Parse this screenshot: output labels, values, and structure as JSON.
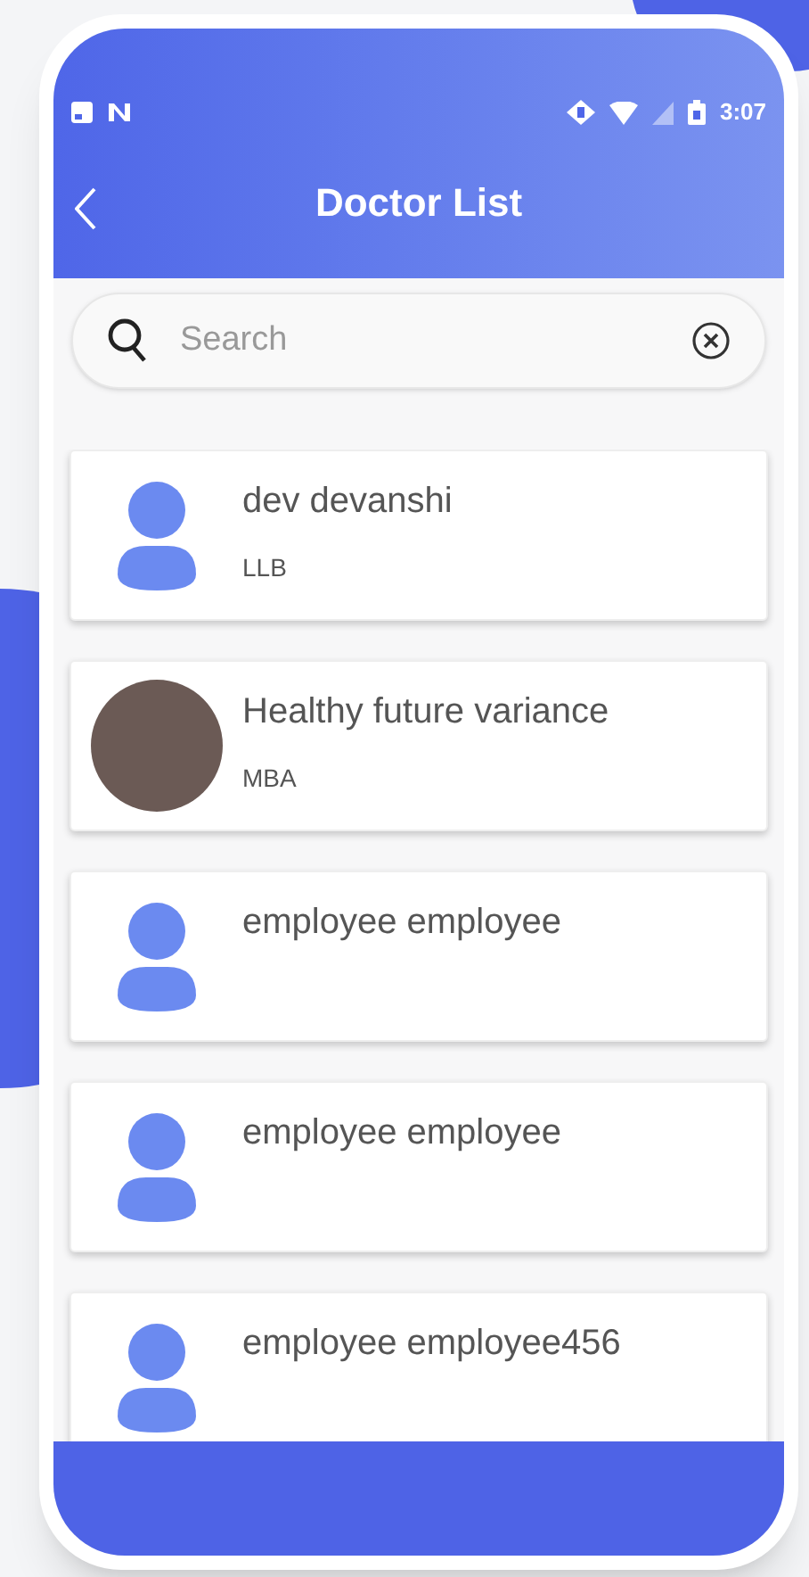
{
  "status_bar": {
    "time": "3:07"
  },
  "header": {
    "title": "Doctor List"
  },
  "search": {
    "placeholder": "Search"
  },
  "doctors": [
    {
      "name": "dev devanshi",
      "degree": "LLB",
      "kind": "default"
    },
    {
      "name": "Healthy future variance",
      "degree": "MBA",
      "kind": "photo"
    },
    {
      "name": "employee employee",
      "kind": "default"
    },
    {
      "name": "employee employee",
      "kind": "default"
    },
    {
      "name": "employee employee456",
      "kind": "default"
    }
  ]
}
